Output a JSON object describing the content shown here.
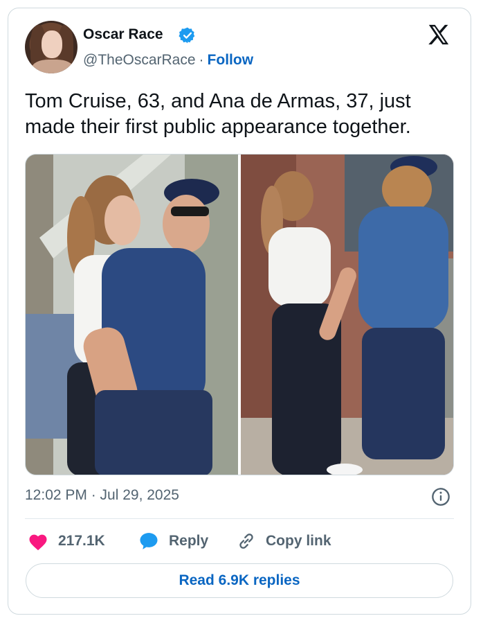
{
  "author": {
    "name": "Oscar Race",
    "handle": "@TheOscarRace",
    "separator": "·",
    "follow_label": "Follow"
  },
  "tweet": {
    "text": "Tom Cruise, 63, and Ana de Armas, 37, just made their first public appearance together."
  },
  "meta": {
    "timestamp": "12:02 PM · Jul 29, 2025"
  },
  "actions": {
    "like_count": "217.1K",
    "reply_label": "Reply",
    "copy_label": "Copy link"
  },
  "footer": {
    "read_replies_label": "Read 6.9K replies"
  },
  "colors": {
    "brand_blue": "#1d9bf0",
    "link_blue": "#0a66c2",
    "like_pink": "#f91880",
    "text_primary": "#0f1419",
    "text_secondary": "#536471"
  },
  "icons": {
    "verified": "verified-badge-icon",
    "platform": "x-logo-icon",
    "info": "info-icon",
    "like": "heart-icon",
    "reply": "speech-bubble-icon",
    "copy": "link-icon"
  }
}
